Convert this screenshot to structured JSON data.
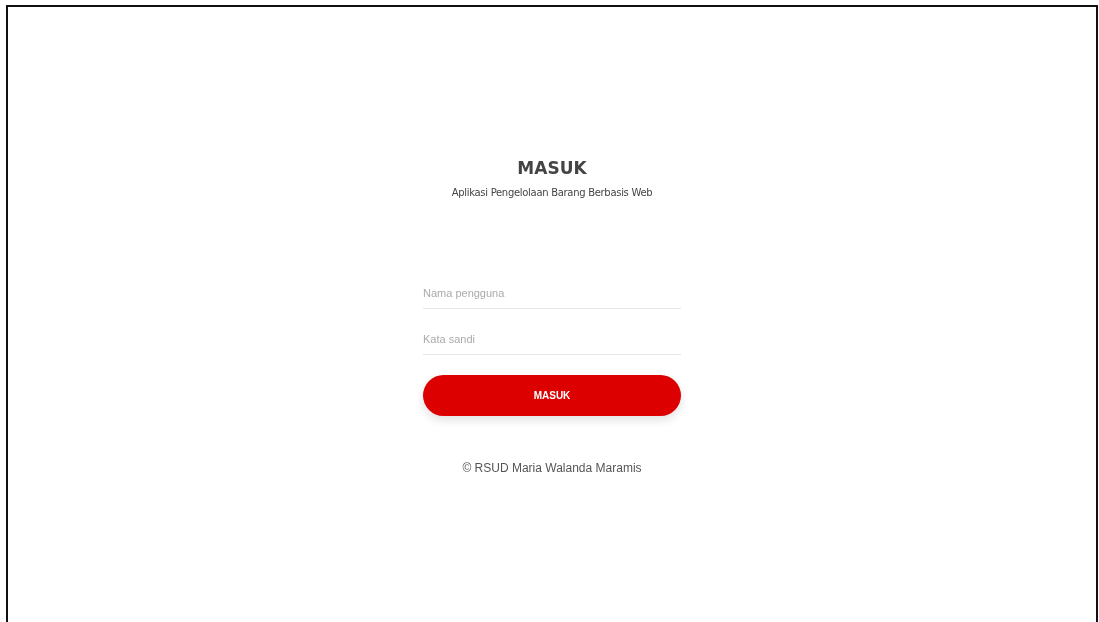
{
  "heading": {
    "title": "MASUK",
    "subtitle": "Aplikasi Pengelolaan Barang Berbasis Web"
  },
  "fields": [
    {
      "placeholder": "Nama pengguna"
    },
    {
      "placeholder": "Kata sandi"
    }
  ],
  "button": "MASUK",
  "footer": "© RSUD Maria Walanda Maramis"
}
